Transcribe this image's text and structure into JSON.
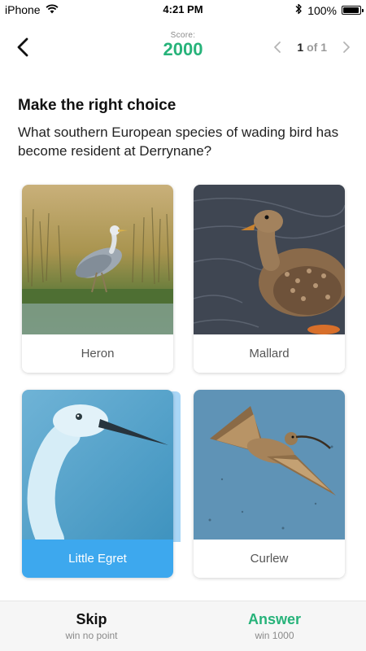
{
  "status_bar": {
    "carrier": "iPhone",
    "time": "4:21 PM",
    "battery": "100%",
    "battery_level": 1.0
  },
  "header": {
    "score_label": "Score:",
    "score_value": "2000",
    "pager_current": "1",
    "pager_of": "of 1"
  },
  "question": {
    "title": "Make the right choice",
    "text": "What southern European species of wading bird has become resident at Derrynane?"
  },
  "choices": [
    {
      "label": "Heron",
      "selected": false
    },
    {
      "label": "Mallard",
      "selected": false
    },
    {
      "label": "Little Egret",
      "selected": true
    },
    {
      "label": "Curlew",
      "selected": false
    }
  ],
  "bottom": {
    "skip_title": "Skip",
    "skip_sub": "win no point",
    "answer_title": "Answer",
    "answer_sub": "win 1000"
  },
  "colors": {
    "accent_green": "#27b37a",
    "selected_blue": "#3da8ee"
  },
  "icons": [
    "wifi-icon",
    "bluetooth-icon",
    "battery-icon",
    "back-arrow-icon",
    "chevron-left-icon",
    "chevron-right-icon"
  ]
}
